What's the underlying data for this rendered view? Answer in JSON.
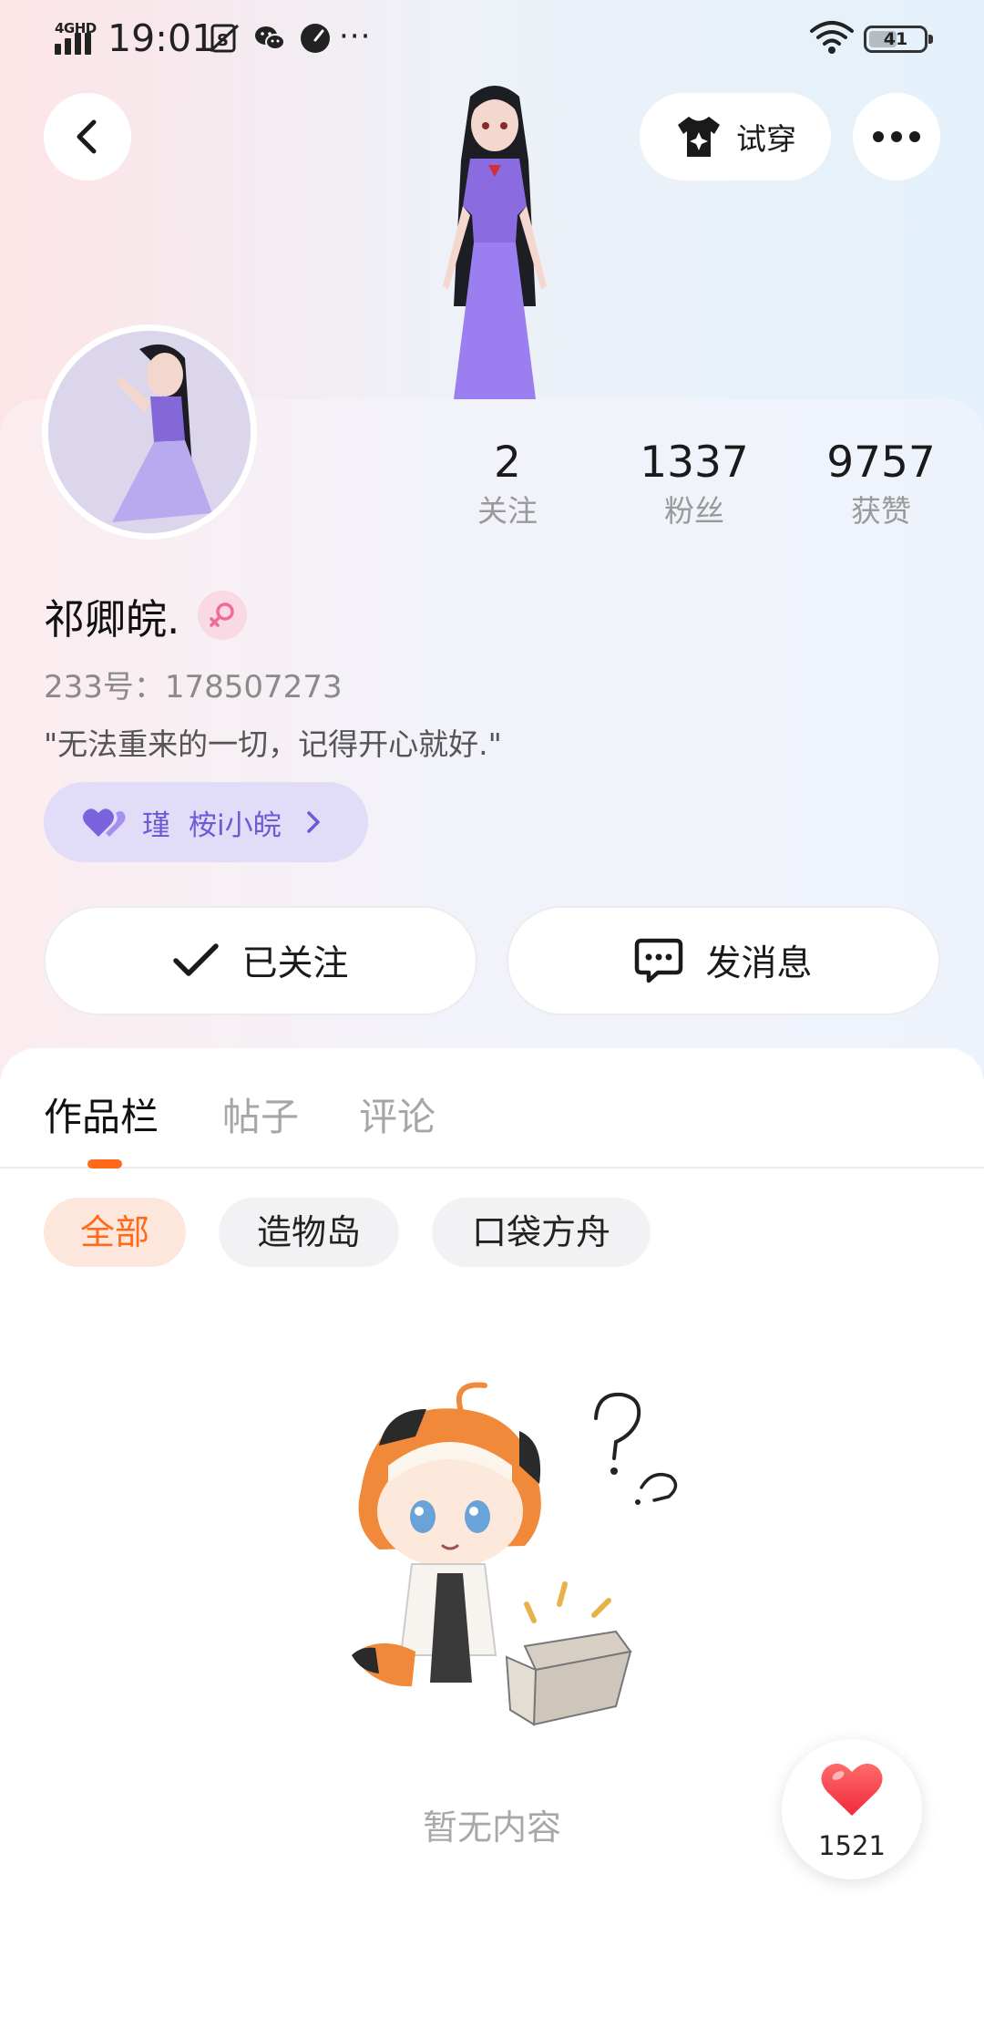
{
  "status_bar": {
    "network": "4GHD",
    "time": "19:01",
    "more": "···",
    "battery": "41"
  },
  "header": {
    "tryon_label": "试穿"
  },
  "profile": {
    "stats": [
      {
        "value": "2",
        "label": "关注"
      },
      {
        "value": "1337",
        "label": "粉丝"
      },
      {
        "value": "9757",
        "label": "获赞"
      }
    ],
    "nickname": "祁卿皖.",
    "uid": "233号：178507273",
    "bio": "\"无法重来的一切，记得开心就好.\"",
    "cp": {
      "name_a": "瑾",
      "name_b": "桉i小皖"
    },
    "follow_label": "已关注",
    "message_label": "发消息"
  },
  "tabs": [
    "作品栏",
    "帖子",
    "评论"
  ],
  "filters": [
    "全部",
    "造物岛",
    "口袋方舟"
  ],
  "empty_text": "暂无内容",
  "like_count": "1521",
  "colors": {
    "accent": "#ff6a1a",
    "cp_purple": "#6d5bd6",
    "cp_bg": "#e1dcf7",
    "muted": "#a6a6a6"
  }
}
